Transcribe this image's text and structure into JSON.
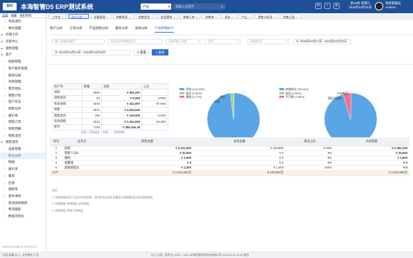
{
  "app": {
    "title": "本海智管D5 ERP测试系统",
    "logo": "BH",
    "product_select": "产品",
    "search_placeholder": "请输入关键字",
    "date_line1": "第16周 星期三",
    "date_line2": "2025年04月30日",
    "user_line1": "系统管理员",
    "user_line2": "Anthem"
  },
  "sidebar": {
    "tabs": [
      "菜单",
      "收藏",
      "组织架构"
    ],
    "items": [
      {
        "label": "系统通告",
        "icon": "doc-icon",
        "group": false,
        "active": false
      },
      {
        "label": "事务提醒",
        "icon": "bell-icon",
        "group": false,
        "active": false
      },
      {
        "label": "为我工作",
        "icon": "briefcase-icon",
        "group": true,
        "active": false
      },
      {
        "label": "流程中心",
        "icon": "flow-icon",
        "group": true,
        "active": false
      },
      {
        "label": "销售管理",
        "icon": "cart-icon",
        "group": true,
        "active": false
      },
      {
        "label": "客户",
        "icon": "person-icon",
        "group": true,
        "active": false
      },
      {
        "label": "线索管理",
        "icon": "lead-icon",
        "group": false,
        "active": false
      },
      {
        "label": "客户服务管理",
        "icon": "service-icon",
        "group": false,
        "active": false
      },
      {
        "label": "跟进记录",
        "icon": "note-icon",
        "group": false,
        "active": false
      },
      {
        "label": "项目管理",
        "icon": "project-icon",
        "group": false,
        "active": false
      },
      {
        "label": "物流地址",
        "icon": "truck-icon",
        "group": false,
        "active": false
      },
      {
        "label": "销售计划",
        "icon": "plan-icon",
        "group": false,
        "active": false
      },
      {
        "label": "客户日志",
        "icon": "log-icon",
        "group": false,
        "active": false
      },
      {
        "label": "销售任务",
        "icon": "task-icon",
        "group": false,
        "active": false
      },
      {
        "label": "报价单",
        "icon": "quote-icon",
        "group": false,
        "active": false
      },
      {
        "label": "销售订单",
        "icon": "order-icon",
        "group": false,
        "active": false
      },
      {
        "label": "销售明细",
        "icon": "detail-icon",
        "group": false,
        "active": false
      },
      {
        "label": "销售退货",
        "icon": "return-icon",
        "group": false,
        "active": false
      },
      {
        "label": "销售提货",
        "icon": "pickup-icon",
        "group": true,
        "active": false
      },
      {
        "label": "设备管理",
        "icon": "device-icon",
        "group": false,
        "active": false
      },
      {
        "label": "积分分析",
        "icon": "chart-icon",
        "group": false,
        "active": true
      },
      {
        "label": "网络",
        "icon": "network-icon",
        "group": false,
        "active": false
      },
      {
        "label": "报价单",
        "icon": "quote-icon",
        "group": false,
        "active": false
      },
      {
        "label": "报审",
        "icon": "audit-icon",
        "group": false,
        "active": false
      },
      {
        "label": "应收",
        "icon": "money-icon",
        "group": false,
        "active": false
      },
      {
        "label": "通知单",
        "icon": "notice-icon",
        "group": false,
        "active": false
      },
      {
        "label": "遗失清单",
        "icon": "list-icon",
        "group": false,
        "active": false
      },
      {
        "label": "退货收款跟踪",
        "icon": "track-icon",
        "group": false,
        "active": false
      },
      {
        "label": "物流跟踪",
        "icon": "logistics-icon",
        "group": false,
        "active": false
      },
      {
        "label": "数据可视化",
        "icon": "visual-icon",
        "group": false,
        "active": false
      }
    ],
    "footer_note": "benhi.com build at 2025-04-29"
  },
  "pagetabs": [
    {
      "label": "工作台",
      "active": false
    },
    {
      "label": "积分分析",
      "active": true
    },
    {
      "label": "设备管理",
      "active": false
    },
    {
      "label": "销售报表",
      "active": false
    },
    {
      "label": "销售提货",
      "active": false
    },
    {
      "label": "退货跟踪",
      "active": false
    },
    {
      "label": "销售订单",
      "active": false
    },
    {
      "label": "销售单",
      "active": false
    },
    {
      "label": "报价",
      "active": false
    },
    {
      "label": "产品",
      "active": false
    },
    {
      "label": "销售分析表",
      "active": false
    },
    {
      "label": "销售记录",
      "active": false
    }
  ],
  "main": {
    "tabs": [
      {
        "label": "客户分析",
        "active": false
      },
      {
        "label": "订单分析",
        "active": false
      },
      {
        "label": "产品销售分析",
        "active": false
      },
      {
        "label": "服务分析",
        "active": false
      },
      {
        "label": "采购分析",
        "active": false
      },
      {
        "label": "产品积销统计",
        "active": true
      }
    ],
    "filters": {
      "f1": "输入品牌关键字",
      "f2": "产品名称/规格/型号",
      "f3": "选择/输入分类",
      "f4": "仓库",
      "f5": "采购状态",
      "date1_start": "2025年04月01日",
      "date1_end": "2025年04月30日",
      "date2_start": "2025年04月01日",
      "date2_end": "2025年04月30日",
      "query_btn": "查询",
      "reset_btn": "重置"
    },
    "stats": {
      "headers": [
        "统计项",
        "数量",
        "金额",
        "占比"
      ],
      "rows": [
        [
          "采购",
          "2062",
          "¥ 451,297",
          ""
        ],
        [
          "采购退货",
          "84",
          "¥ 9,300",
          "2.06%"
        ],
        [
          "有效采购",
          "1978",
          "¥ 441,997",
          "97.94%"
        ],
        [
          "销售",
          "2871",
          "¥ 2,544,500",
          ""
        ],
        [
          "销售退货",
          "152",
          "¥ 140,500",
          "5.52%"
        ],
        [
          "有效销售",
          "2513",
          "¥ 2,404,000",
          "94.48%"
        ],
        [
          "库存",
          "7193",
          "¥ 385,164.39",
          ""
        ]
      ]
    },
    "breadcrumb": "采购 > 采购退货 > 有效 ...... 有效销售"
  },
  "charts": {
    "legend_left": [
      {
        "label": "采购 (100.00%)",
        "color": "#5aa5e6"
      },
      {
        "label": "退货 (2.06%)",
        "color": "#9fd67c"
      },
      {
        "label": "调拨 (0.17%)",
        "color": "#ff6b8a"
      }
    ],
    "legend_right": [
      {
        "label": "新增成交 (95.04%)",
        "color": "#5aa5e6"
      },
      {
        "label": "退货 (0.00%)",
        "color": "#9fd67c"
      },
      {
        "label": "不可售 (4.96%)",
        "color": "#ff6b8a"
      }
    ],
    "left_label_top": "退货",
    "left_label_mid": "分销",
    "left_label_bottom": "采购",
    "right_label_top1": "卡布集团",
    "right_label_top2": "国际代理商",
    "right_label_bottom": "新增自建"
  },
  "chart_data": [
    {
      "type": "pie",
      "title": "",
      "categories": [
        "采购",
        "退货",
        "调拨"
      ],
      "values": [
        97.77,
        2.06,
        0.17
      ],
      "colors": [
        "#5aa5e6",
        "#9fd67c",
        "#ff6b8a"
      ],
      "legend": "top-left"
    },
    {
      "type": "pie",
      "title": "",
      "categories": [
        "新增成交",
        "退货",
        "不可售"
      ],
      "values": [
        95.04,
        0.0,
        4.96
      ],
      "colors": [
        "#5aa5e6",
        "#9fd67c",
        "#ff6b8a"
      ],
      "legend": "top-left"
    }
  ],
  "detail": {
    "headers": [
      "序号",
      "业务员",
      "销售金额",
      "退货金额",
      "退货占比",
      "有效销售"
    ],
    "rows": [
      [
        "1",
        "起耶",
        "¥ 2,421,600",
        "¥ 139,500",
        "5.53%",
        "¥ 2,382,100"
      ],
      [
        "2",
        "销售人员D",
        "¥ 20,000",
        "¥ 0",
        "0%",
        "¥ 20,000"
      ],
      [
        "3",
        "路刚",
        "¥ 1,900",
        "¥ 0",
        "0%",
        "¥ 1,900"
      ],
      [
        "4",
        "逄鑫瑞",
        "¥ 0",
        "¥ 0",
        "0%",
        "¥ 0"
      ],
      [
        "5",
        "超级管理员",
        "¥ 1,000",
        "¥ 1,000",
        "100%",
        "¥ 0"
      ]
    ],
    "sum": [
      "小计",
      "",
      "¥ 2,544,500元",
      "¥ 140,500元",
      "",
      "¥ 2,404,000元"
    ]
  },
  "notes": [
    "说明:",
    "1. 采购数据来源于业务中的采购单，同时和去自动生成期限于确保期会形成的采购数据。",
    "2. 有效数量=销售数量-退货数量。",
    "3. 销售数量=销售订单数量。"
  ],
  "footer": {
    "left": "Lx1 机器 | 1.x",
    "center": "[以上为序，提供方] 2019 ~ 2022 本海智管软件科技有限公司 2025-05-04 23:59 使用",
    "right": "",
    "status_left": "应用 收藏 导入 | 文件服务 产品"
  }
}
